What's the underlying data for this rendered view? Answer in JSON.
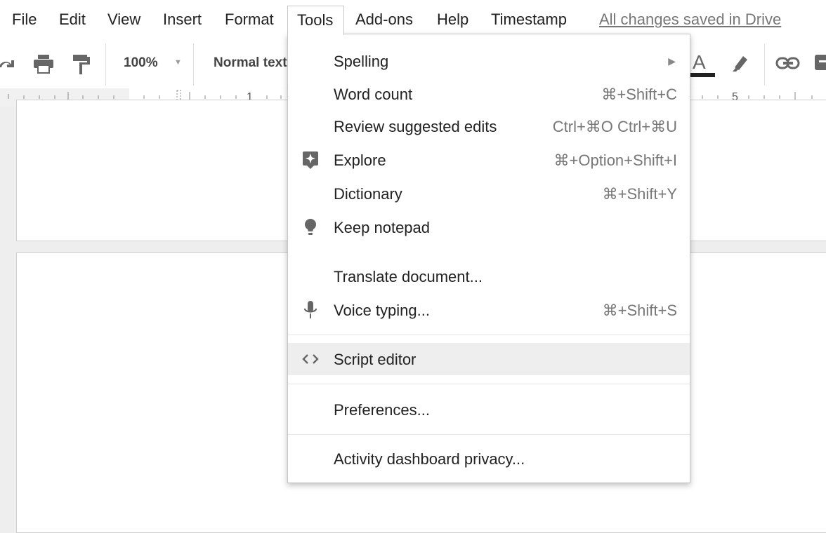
{
  "menubar": {
    "items": [
      "File",
      "Edit",
      "View",
      "Insert",
      "Format",
      "Tools",
      "Add-ons",
      "Help",
      "Timestamp"
    ],
    "open_item": "Tools",
    "save_status": "All changes saved in Drive"
  },
  "toolbar": {
    "zoom": "100%",
    "paragraph_style": "Normal text",
    "icons": [
      "redo-icon",
      "print-icon",
      "paint-format-icon",
      "text-color-icon",
      "highlight-icon",
      "link-icon",
      "comment-icon"
    ]
  },
  "ruler": {
    "labels": [
      "1",
      "5"
    ]
  },
  "tools_menu": {
    "items": [
      {
        "label": "Spelling",
        "shortcut": "",
        "submenu": true,
        "icon": ""
      },
      {
        "label": "Word count",
        "shortcut": "⌘+Shift+C",
        "icon": ""
      },
      {
        "label": "Review suggested edits",
        "shortcut": "Ctrl+⌘O Ctrl+⌘U",
        "icon": ""
      },
      {
        "label": "Explore",
        "shortcut": "⌘+Option+Shift+I",
        "icon": "explore-icon"
      },
      {
        "label": "Dictionary",
        "shortcut": "⌘+Shift+Y",
        "icon": ""
      },
      {
        "label": "Keep notepad",
        "shortcut": "",
        "icon": "lightbulb-icon"
      },
      {
        "label": "Translate document...",
        "shortcut": "",
        "icon": ""
      },
      {
        "label": "Voice typing...",
        "shortcut": "⌘+Shift+S",
        "icon": "microphone-icon"
      },
      {
        "label": "Script editor",
        "shortcut": "",
        "icon": "code-icon",
        "highlighted": true
      },
      {
        "label": "Preferences...",
        "shortcut": "",
        "icon": ""
      },
      {
        "label": "Activity dashboard privacy...",
        "shortcut": "",
        "icon": ""
      }
    ]
  },
  "colors": {
    "menu_hover": "#eeeeee",
    "text_color_bar": "#222222",
    "icon_gray": "#666666"
  }
}
